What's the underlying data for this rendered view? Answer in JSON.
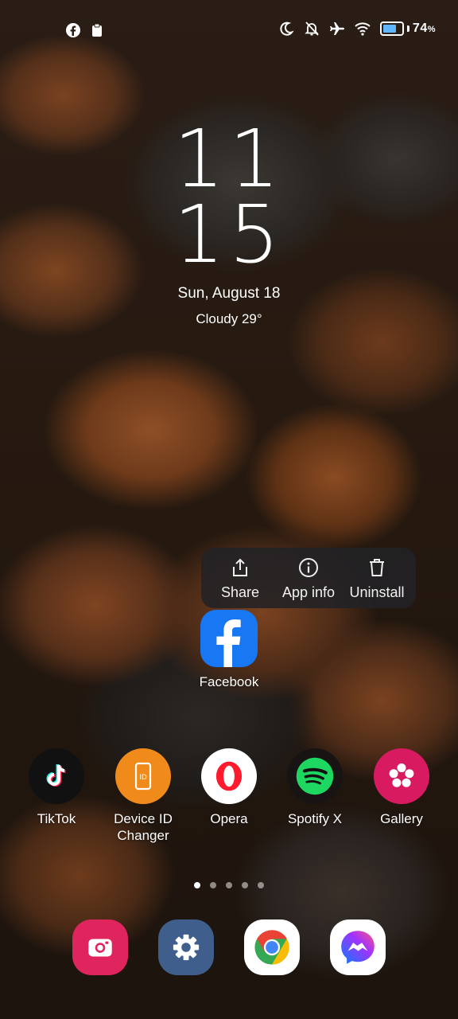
{
  "status_bar": {
    "left_icons": [
      "facebook-notification-icon",
      "clipboard-icon"
    ],
    "right_icons": [
      "moon-icon",
      "bell-off-icon",
      "airplane-icon",
      "wifi-icon",
      "battery-icon"
    ],
    "battery_level": 0.74,
    "battery_percent": "74",
    "battery_unit": "%"
  },
  "clock": {
    "hour": "11",
    "minute": "15",
    "date": "Sun, August 18",
    "weather": "Cloudy  29°"
  },
  "context_menu": {
    "items": [
      {
        "label": "Share",
        "icon": "share-icon"
      },
      {
        "label": "App info",
        "icon": "info-icon"
      },
      {
        "label": "Uninstall",
        "icon": "trash-icon"
      }
    ]
  },
  "focused_app": {
    "label": "Facebook",
    "color": "#1877F2"
  },
  "apps": [
    {
      "label": "TikTok",
      "color": "#111111"
    },
    {
      "label": "Device ID\nChanger",
      "color": "#F08A1A"
    },
    {
      "label": "Opera",
      "color": "#FFFFFF"
    },
    {
      "label": "Spotify X",
      "color": "#191414"
    },
    {
      "label": "Gallery",
      "color": "#D81B60"
    }
  ],
  "page_indicator": {
    "count": 5,
    "active": 0
  },
  "dock": [
    {
      "name": "camera",
      "color": "#E0245E"
    },
    {
      "name": "settings",
      "color": "#3F5E8C"
    },
    {
      "name": "chrome",
      "color": "#FFFFFF"
    },
    {
      "name": "messenger",
      "color": "#FFFFFF"
    }
  ]
}
